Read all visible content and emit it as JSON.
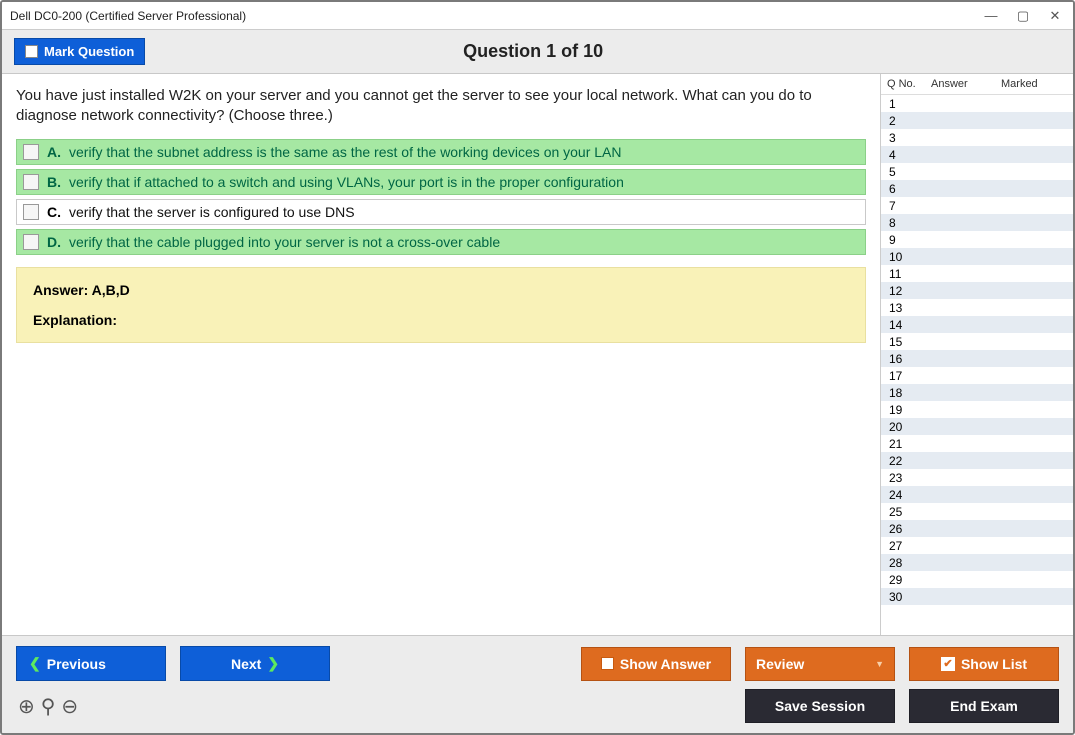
{
  "title": "Dell DC0-200 (Certified Server Professional)",
  "header": {
    "mark_label": "Mark Question",
    "question_heading": "Question 1 of 10"
  },
  "question": {
    "text": "You have just installed W2K on your server and you cannot get the server to see your local network. What can you do to diagnose network connectivity? (Choose three.)",
    "choices": [
      {
        "letter": "A.",
        "text": "verify that the subnet address is the same as the rest of the working devices on your LAN",
        "highlight": true
      },
      {
        "letter": "B.",
        "text": "verify that if attached to a switch and using VLANs, your port is in the proper configuration",
        "highlight": true
      },
      {
        "letter": "C.",
        "text": "verify that the server is configured to use DNS",
        "highlight": false
      },
      {
        "letter": "D.",
        "text": "verify that the cable plugged into your server is not a cross-over cable",
        "highlight": true
      }
    ],
    "answer_label": "Answer:",
    "answer_value": "A,B,D",
    "explanation_label": "Explanation:"
  },
  "sidebar": {
    "headers": {
      "qno": "Q No.",
      "answer": "Answer",
      "marked": "Marked"
    },
    "rows": [
      1,
      2,
      3,
      4,
      5,
      6,
      7,
      8,
      9,
      10,
      11,
      12,
      13,
      14,
      15,
      16,
      17,
      18,
      19,
      20,
      21,
      22,
      23,
      24,
      25,
      26,
      27,
      28,
      29,
      30
    ]
  },
  "footer": {
    "previous": "Previous",
    "next": "Next",
    "show_answer": "Show Answer",
    "review": "Review",
    "show_list": "Show List",
    "save_session": "Save Session",
    "end_exam": "End Exam"
  }
}
